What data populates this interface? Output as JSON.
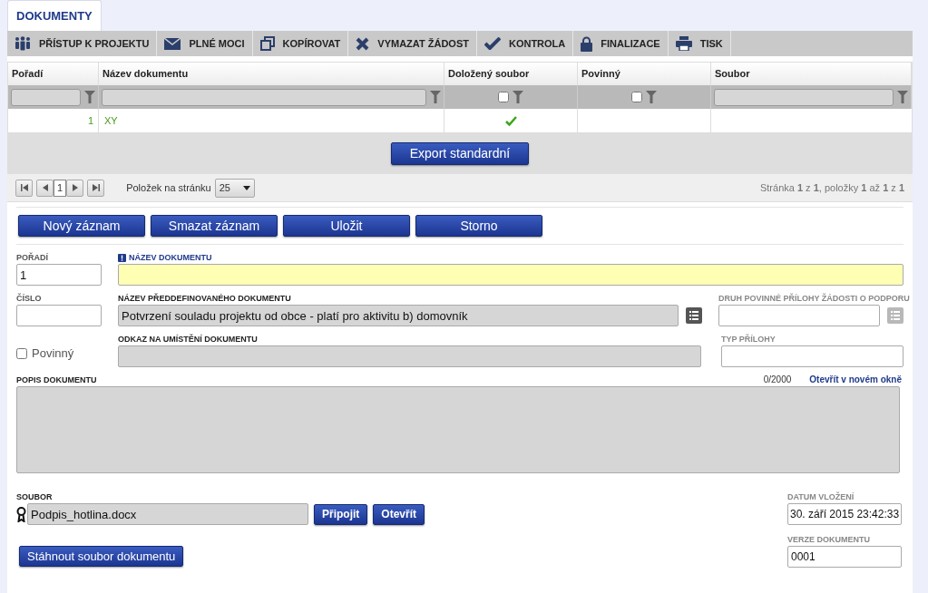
{
  "tab": {
    "label": "DOKUMENTY",
    "selected": true
  },
  "toolbar": [
    {
      "label": "PŘÍSTUP K PROJEKTU"
    },
    {
      "label": "PLNÉ MOCI"
    },
    {
      "label": "KOPÍROVAT"
    },
    {
      "label": "VYMAZAT ŽÁDOST"
    },
    {
      "label": "KONTROLA"
    },
    {
      "label": "FINALIZACE"
    },
    {
      "label": "TISK"
    }
  ],
  "table": {
    "columns": [
      {
        "label": "Pořadí",
        "filter": {
          "kind": "text"
        }
      },
      {
        "label": "Název dokumentu",
        "filter": {
          "kind": "text"
        }
      },
      {
        "label": "Doložený soubor",
        "filter": {
          "kind": "checkbox",
          "checked": false
        }
      },
      {
        "label": "Povinný",
        "filter": {
          "kind": "checkbox",
          "checked": false
        }
      },
      {
        "label": "Soubor",
        "filter": {
          "kind": "text"
        }
      }
    ],
    "rows": [
      {
        "order": "1",
        "name": "XY",
        "file_attached": true,
        "mandatory": false
      }
    ]
  },
  "export_button": "Export standardní",
  "pager": {
    "page": "1",
    "per_page_label": "Položek na stránku",
    "per_page": "25",
    "summary": "Stránka **1** z **1**, položky **1** až **1** z **1**"
  },
  "actions": [
    "Nový záznam",
    "Smazat záznam",
    "Uložit",
    "Storno"
  ],
  "form": {
    "order": {
      "label": "POŘADÍ",
      "value": "1"
    },
    "name": {
      "label": "NÁZEV DOKUMENTU",
      "required": true
    },
    "number": {
      "label": "ČÍSLO"
    },
    "predefined": {
      "label": "NÁZEV PŘEDDEFINOVANÉHO DOKUMENTU",
      "value": "Potvrzení souladu projektu od obce - platí pro aktivitu b) domovník"
    },
    "attachment_kind": {
      "label": "DRUH POVINNÉ PŘÍLOHY ŽÁDOSTI O PODPORU"
    },
    "mandatory": {
      "label": "Povinný",
      "checked": false
    },
    "link": {
      "label": "ODKAZ NA UMÍSTĚNÍ DOKUMENTU"
    },
    "attachment_type": {
      "label": "TYP PŘÍLOHY"
    },
    "description": {
      "label": "POPIS DOKUMENTU",
      "counter": "0/2000",
      "open_link": "Otevřít v novém okně"
    },
    "file": {
      "label": "SOUBOR",
      "value": "Podpis_hotlina.docx",
      "buttons": [
        "Připojit",
        "Otevřít"
      ]
    },
    "download_button": "Stáhnout soubor dokumentu",
    "inserted": {
      "label": "DATUM VLOŽENÍ",
      "value": "30. září 2015 23:42:33"
    },
    "version": {
      "label": "VERZE DOKUMENTU",
      "value": "0001"
    }
  }
}
